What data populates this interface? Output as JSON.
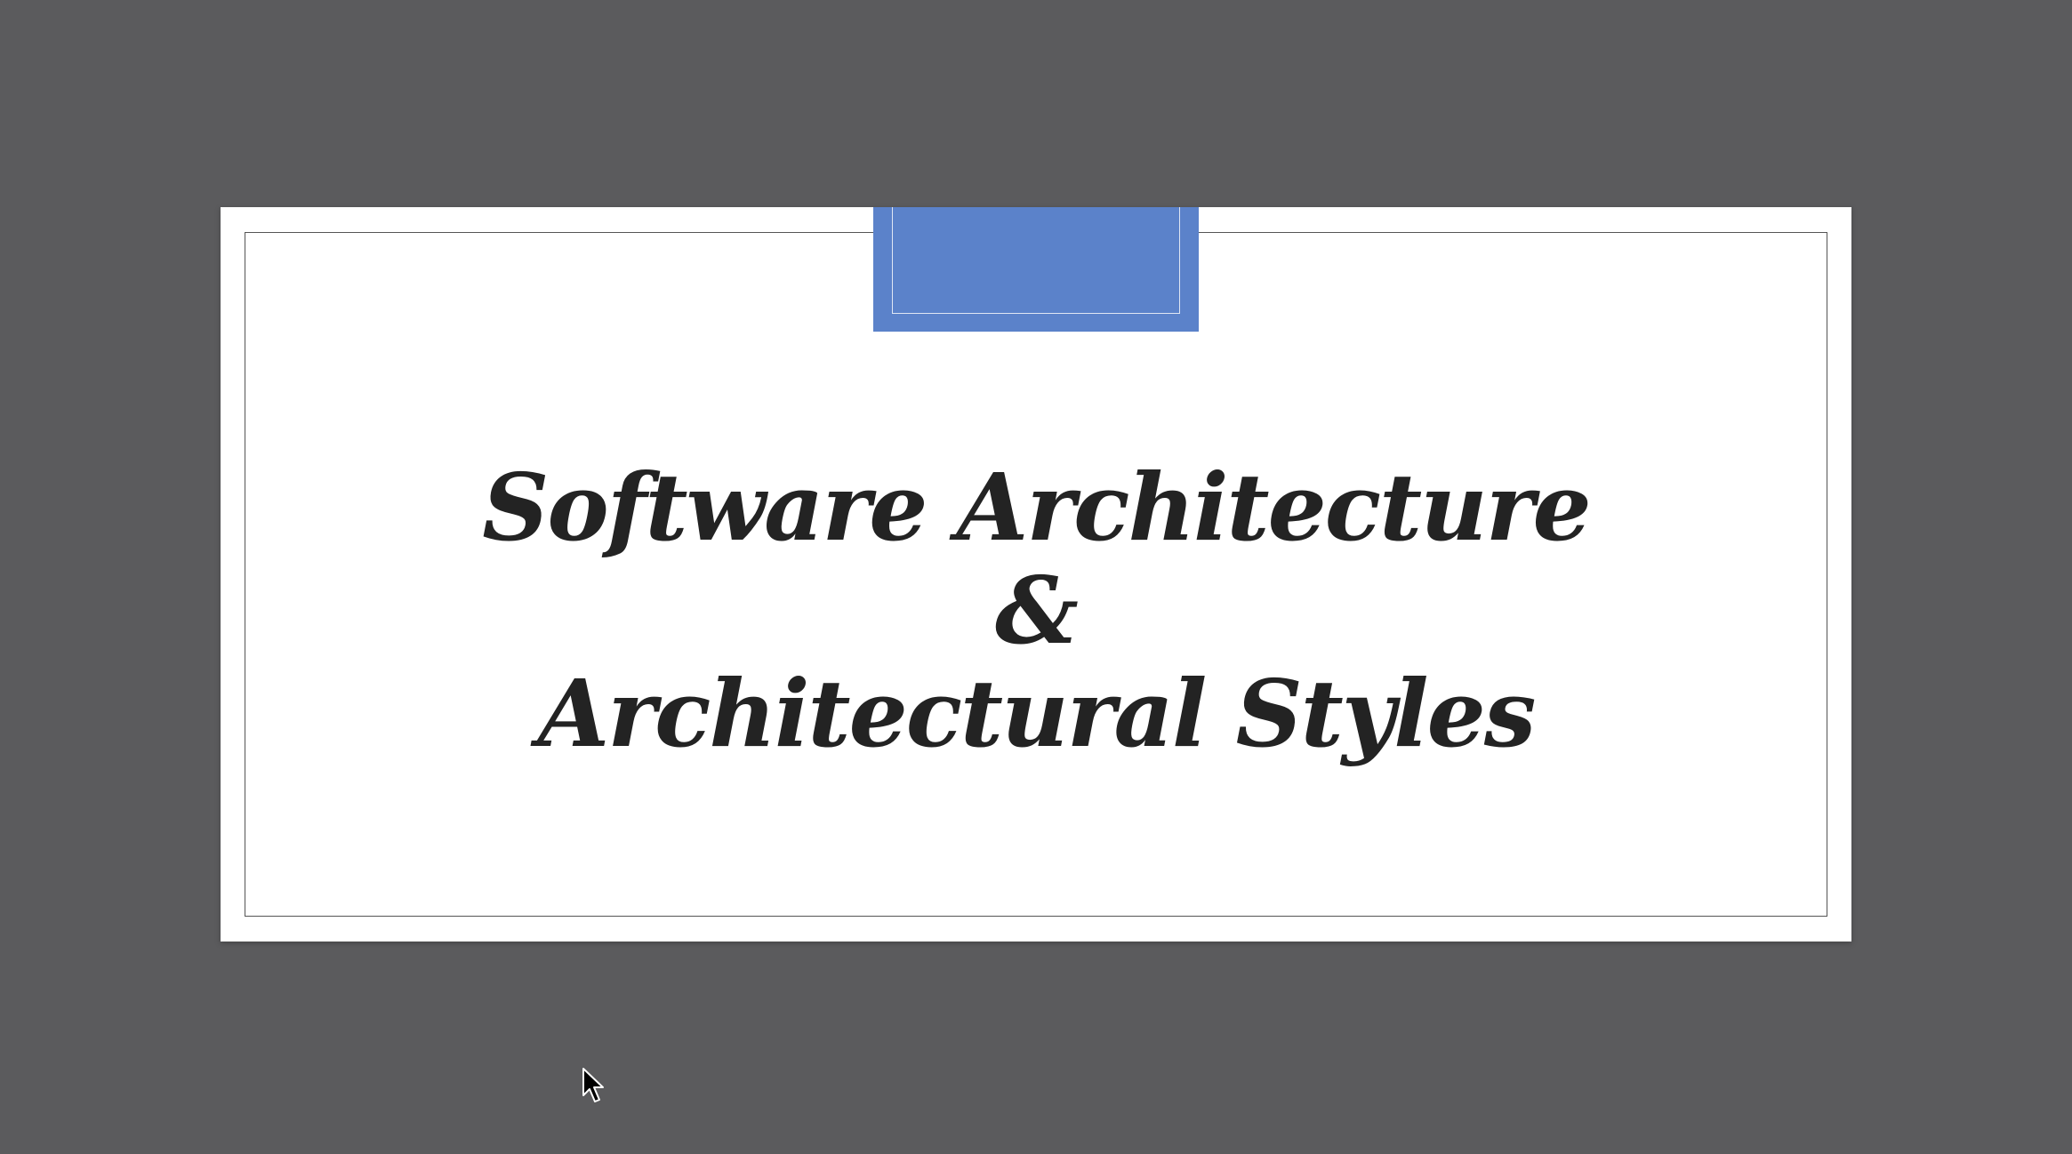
{
  "slide": {
    "title_line_1": "Software Architecture",
    "title_line_2": "&",
    "title_line_3": "Architectural Styles"
  },
  "colors": {
    "background": "#5b5b5d",
    "slide": "#ffffff",
    "accent": "#5b82ca",
    "title_text": "#232323"
  },
  "icons": {
    "cursor": "mouse-pointer-icon"
  }
}
